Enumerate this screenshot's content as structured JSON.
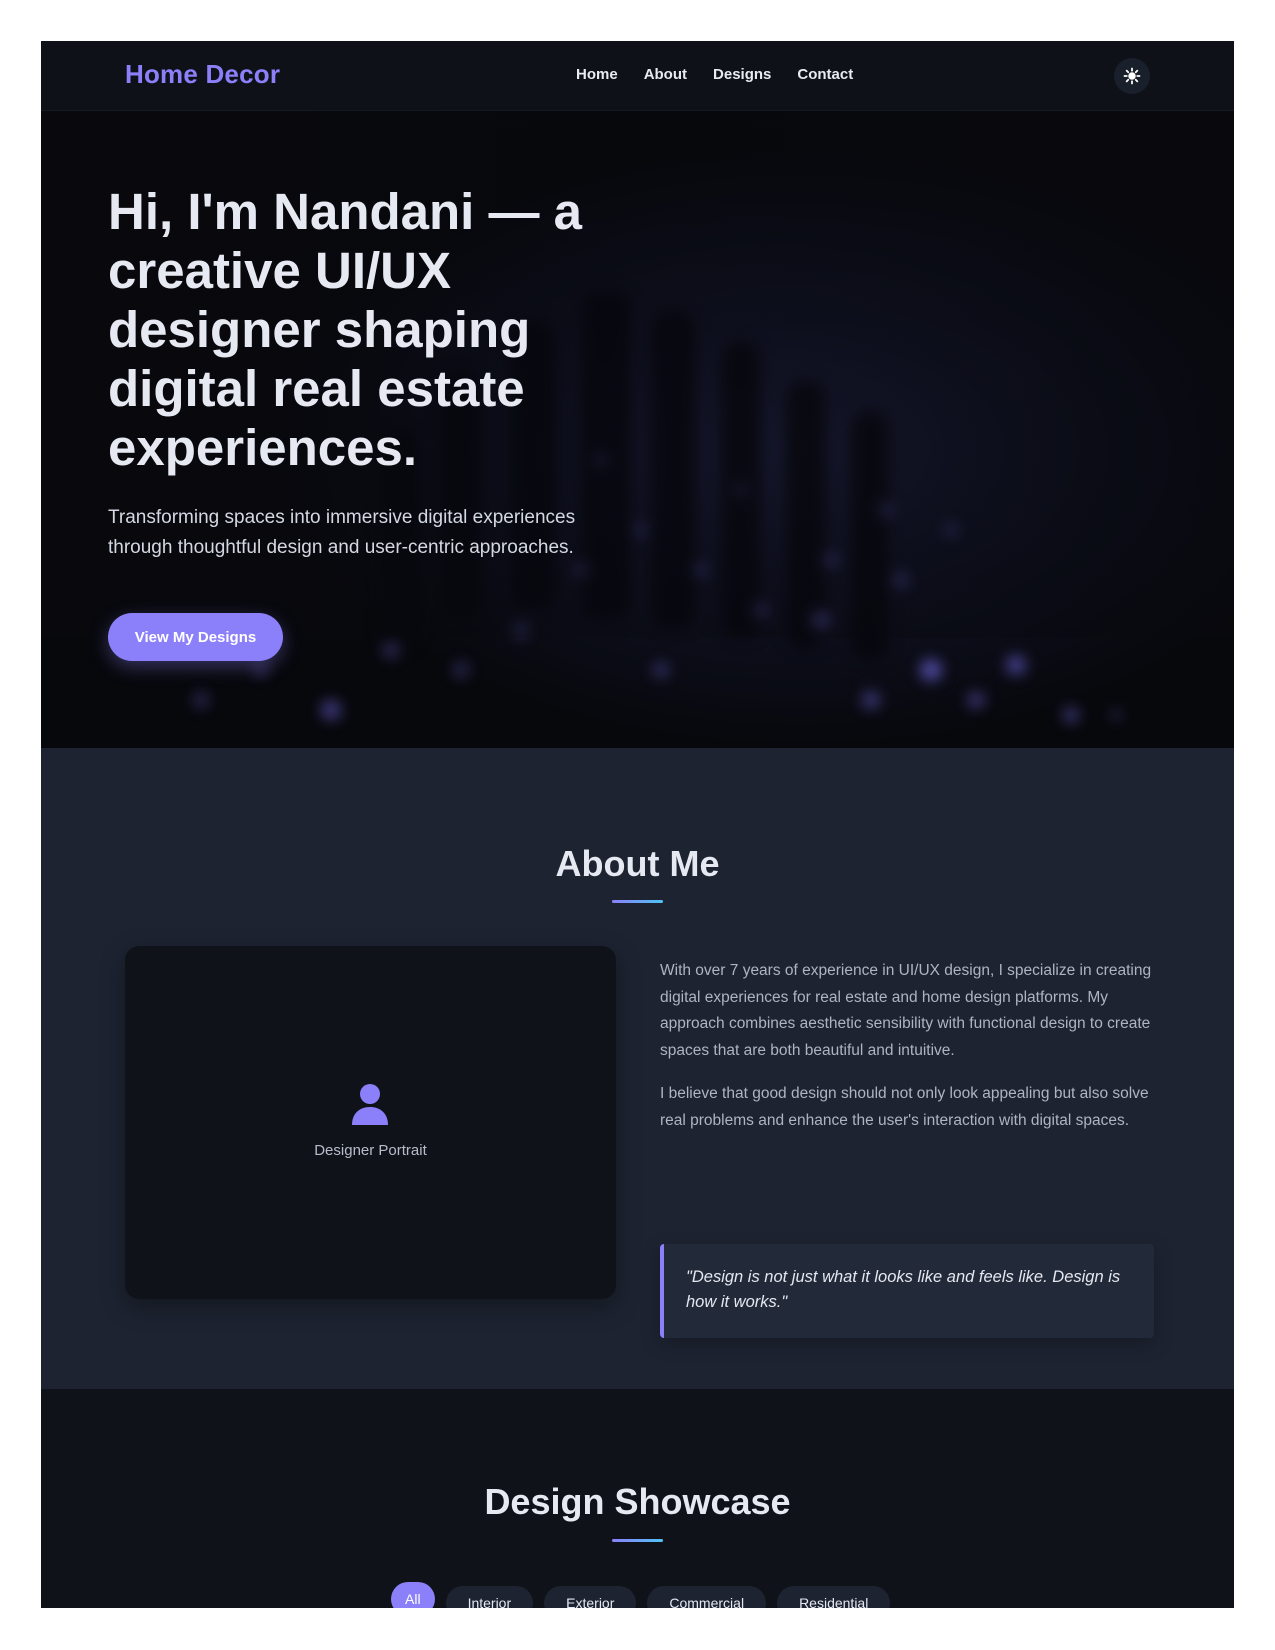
{
  "nav": {
    "brand": "Home Decor",
    "links": [
      "Home",
      "About",
      "Designs",
      "Contact"
    ],
    "theme_toggle_icon": "sun-icon"
  },
  "hero": {
    "title": "Hi, I'm Nandani — a creative UI/UX designer shaping digital real estate experiences.",
    "subtitle": "Transforming spaces into immersive digital experiences through thoughtful design and user-centric approaches.",
    "cta": "View My Designs"
  },
  "about": {
    "title": "About Me",
    "portrait_label": "Designer Portrait",
    "portrait_icon": "user-icon",
    "paragraphs": [
      "With over 7 years of experience in UI/UX design, I specialize in creating digital experiences for real estate and home design platforms. My approach combines aesthetic sensibility with functional design to create spaces that are both beautiful and intuitive.",
      "I believe that good design should not only look appealing but also solve real problems and enhance the user's interaction with digital spaces."
    ],
    "quote": "\"Design is not just what it looks like and feels like. Design is how it works.\""
  },
  "showcase": {
    "title": "Design Showcase",
    "filters": [
      "All",
      "Interior",
      "Exterior",
      "Commercial",
      "Residential"
    ],
    "active_filter": "All"
  },
  "colors": {
    "accent": "#8b80f9",
    "background": "#0f1319",
    "section_alt": "#1d2331"
  }
}
